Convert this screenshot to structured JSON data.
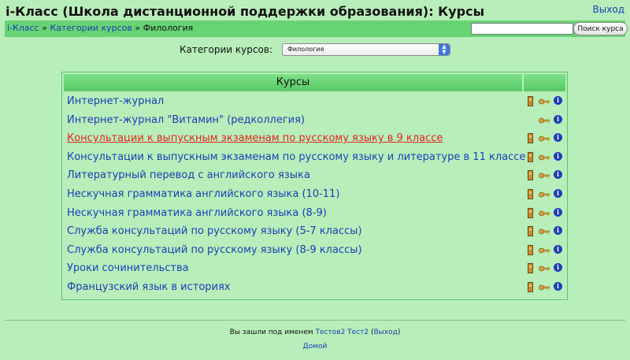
{
  "header": {
    "title": "i-Класс (Школа дистанционной поддержки образования): Курсы",
    "logout_label": "Выход"
  },
  "breadcrumb": {
    "home": "i-Класс",
    "categories": "Категории курсов",
    "current": "Филология",
    "separator": "»"
  },
  "search": {
    "value": "",
    "button_label": "Поиск курса"
  },
  "category": {
    "label": "Категории курсов:",
    "selected": "Филология"
  },
  "table": {
    "header": "Курсы",
    "courses": [
      {
        "name": "Интернет-журнал",
        "active": false,
        "enter_icon": true
      },
      {
        "name": "Интернет-журнал \"Витамин\" (редколлегия)",
        "active": false,
        "enter_icon": false
      },
      {
        "name": "Консультации к выпускным экзаменам по русскому языку в 9 классе",
        "active": true,
        "enter_icon": true
      },
      {
        "name": "Консультации к выпускным экзаменам по русскому языку и литературе в 11 классе",
        "active": false,
        "enter_icon": true
      },
      {
        "name": "Литературный перевод с английского языка",
        "active": false,
        "enter_icon": true
      },
      {
        "name": "Нескучная грамматика английского языка (10-11)",
        "active": false,
        "enter_icon": true
      },
      {
        "name": "Нескучная грамматика английского языка (8-9)",
        "active": false,
        "enter_icon": true
      },
      {
        "name": "Служба консультаций по русскому языку (5-7 классы)",
        "active": false,
        "enter_icon": true
      },
      {
        "name": "Служба консультаций по русскому языку (8-9 классы)",
        "active": false,
        "enter_icon": true
      },
      {
        "name": "Уроки сочинительства",
        "active": false,
        "enter_icon": true
      },
      {
        "name": "Французский язык в историях",
        "active": false,
        "enter_icon": true
      }
    ]
  },
  "footer": {
    "logged_in_prefix": "Вы зашли под именем",
    "user_name": "Тестов2 Тест2",
    "logout_label": "Выход",
    "home_label": "Домой"
  },
  "colors": {
    "background": "#b8eeb9",
    "navbar": "#67d474",
    "link": "#1a3fb8",
    "active_link": "#e0281e"
  }
}
